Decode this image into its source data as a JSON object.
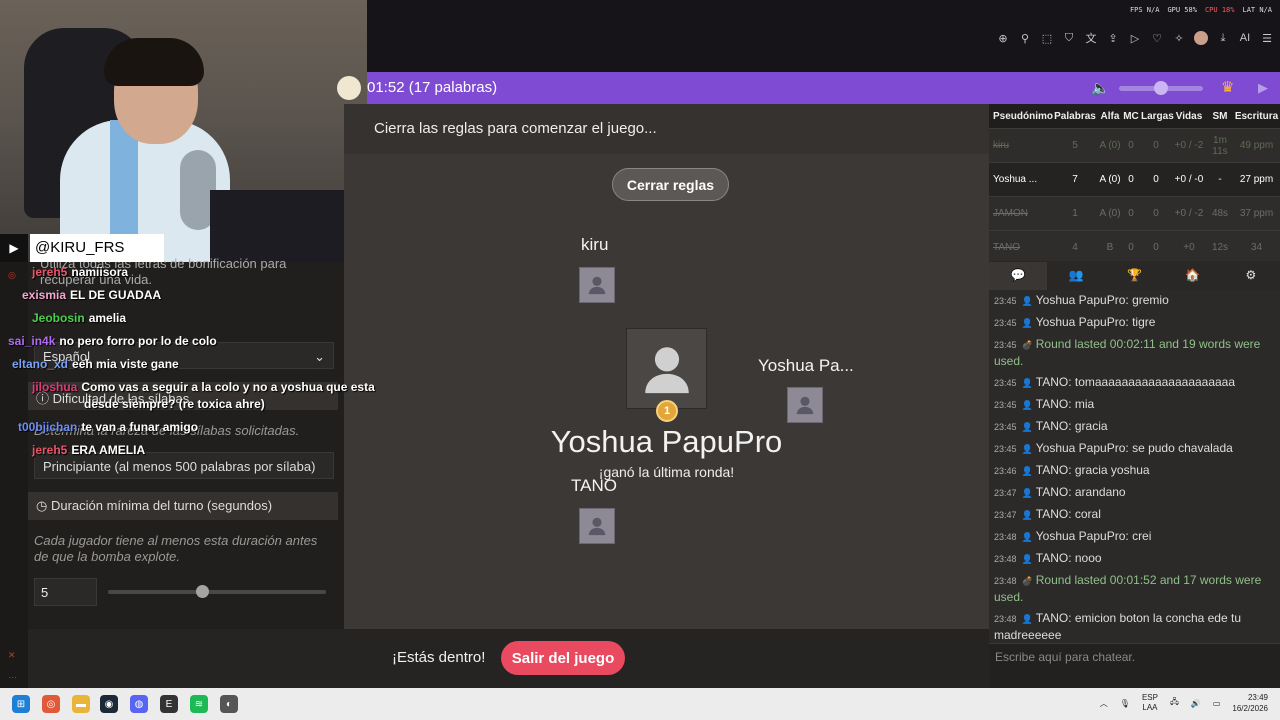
{
  "perf": [
    {
      "label": "FPS N/A",
      "bad": false
    },
    {
      "label": "GPU 58%",
      "bad": false
    },
    {
      "label": "CPU 18%",
      "bad": true
    },
    {
      "label": "LAT N/A",
      "bad": false
    }
  ],
  "toolbar": {
    "icons": [
      "zoom-icon",
      "pin-icon",
      "crop-icon",
      "shield-icon",
      "translate-icon",
      "share-icon",
      "cast-icon",
      "heart-icon",
      "extensions-icon",
      "avatar",
      "download-icon",
      "ai-icon",
      "menu-icon"
    ],
    "ai_label": "AI"
  },
  "game": {
    "timer": "01:52 (17 palabras)",
    "rules_notice": "Cierra las reglas para comenzar el juego...",
    "close_rules": "Cerrar reglas",
    "players": [
      {
        "name": "kiru"
      },
      {
        "name": "Yoshua Pa..."
      },
      {
        "name": "TANO"
      }
    ],
    "winner_rank": "1",
    "winner_name": "Yoshua PapuPro",
    "winner_sub": "¡ganó la última ronda!",
    "inside": "¡Estás dentro!",
    "leave": "Salir del juego"
  },
  "settings": {
    "bonus_hint": "Utiliza todas las letras de bonificación para recuperar una vida.",
    "language": "Español",
    "difficulty_header": "Dificultad de las sílabas",
    "difficulty_hint": "Determina la rareza de las sílabas solicitadas.",
    "difficulty_value": "Principiante (al menos 500 palabras por sílaba)",
    "duration_header": "Duración mínima del turno (segundos)",
    "duration_hint": "Cada jugador tiene al menos esta duración antes de que la bomba explote.",
    "duration_value": "5",
    "duration_level": 0.43
  },
  "stream": {
    "handle": "@KIRU_FRS",
    "chat": [
      {
        "user": "jereh5",
        "text": "namiisora",
        "color": "#e8556b"
      },
      {
        "user": "exismia",
        "text": "EL DE GUADAA",
        "color": "#f4a7d0"
      },
      {
        "user": "Jeobosin",
        "text": "amelia",
        "color": "#4ad14a"
      },
      {
        "user": "sai_in4k",
        "text": "no pero forro por lo de colo",
        "color": "#b06cf0"
      },
      {
        "user": "eltano_xd",
        "text": "eeh mia viste gane",
        "color": "#7aa3f5"
      },
      {
        "user": "jiloshua",
        "text": "Como vas a seguir a la colo y no a yoshua que esta",
        "color": "#e03a7a"
      },
      {
        "user": "",
        "text": "desde siempre? (re toxica ahre)",
        "color": "#fff"
      },
      {
        "user": "t00bjichan",
        "text": "te van a funar amigo",
        "color": "#6b8df5"
      },
      {
        "user": "jereh5",
        "text": "ERA AMELIA",
        "color": "#e8556b"
      }
    ]
  },
  "scoreboard": {
    "headers": [
      "Pseudónimo",
      "Palabras",
      "Alfa",
      "MC",
      "Largas",
      "Vidas",
      "SM",
      "Escritura"
    ],
    "rows": [
      {
        "name": "kiru",
        "words": "5",
        "alpha": "A (0)",
        "mc": "0",
        "long": "0",
        "lives": "+0 / -2",
        "sm": "1m 11s",
        "wpm": "49 ppm",
        "style": "dim"
      },
      {
        "name": "Yoshua ...",
        "words": "7",
        "alpha": "A (0)",
        "mc": "0",
        "long": "0",
        "lives": "+0 / -0",
        "sm": "-",
        "wpm": "27 ppm",
        "style": "bright"
      },
      {
        "name": "JAMON",
        "words": "1",
        "alpha": "A (0)",
        "mc": "0",
        "long": "0",
        "lives": "+0 / -2",
        "sm": "48s",
        "wpm": "37 ppm",
        "style": "dimg"
      },
      {
        "name": "TANO",
        "words": "4",
        "alpha": "B",
        "mc": "0",
        "long": "0",
        "lives": "+0",
        "sm": "12s",
        "wpm": "34",
        "style": "dimg"
      }
    ]
  },
  "chat": {
    "tabs": [
      "chat-icon",
      "people-icon",
      "trophy-icon",
      "home-icon",
      "settings-icon"
    ],
    "messages": [
      {
        "time": "23:45",
        "user": "Yoshua PapuPro",
        "text": "gremio",
        "sys": false
      },
      {
        "time": "23:45",
        "user": "Yoshua PapuPro",
        "text": "tigre",
        "sys": false
      },
      {
        "time": "23:45",
        "user": "",
        "text": "Round lasted 00:02:11 and 19 words were used.",
        "sys": true
      },
      {
        "time": "23:45",
        "user": "TANO",
        "text": "tomaaaaaaaaaaaaaaaaaaaaa",
        "sys": false
      },
      {
        "time": "23:45",
        "user": "TANO",
        "text": "mia",
        "sys": false
      },
      {
        "time": "23:45",
        "user": "TANO",
        "text": "gracia",
        "sys": false
      },
      {
        "time": "23:45",
        "user": "Yoshua PapuPro",
        "text": "se pudo chavalada",
        "sys": false
      },
      {
        "time": "23:46",
        "user": "TANO",
        "text": "gracia yoshua",
        "sys": false
      },
      {
        "time": "23:47",
        "user": "TANO",
        "text": "arandano",
        "sys": false
      },
      {
        "time": "23:47",
        "user": "TANO",
        "text": "coral",
        "sys": false
      },
      {
        "time": "23:48",
        "user": "Yoshua PapuPro",
        "text": "crei",
        "sys": false
      },
      {
        "time": "23:48",
        "user": "TANO",
        "text": "nooo",
        "sys": false
      },
      {
        "time": "23:48",
        "user": "",
        "text": "Round lasted 00:01:52 and 17 words were used.",
        "sys": true
      },
      {
        "time": "23:48",
        "user": "TANO",
        "text": "emicion boton la concha ede tu madreeeeee",
        "sys": false
      }
    ],
    "placeholder": "Escribe aquí para chatear."
  },
  "taskbar": {
    "lang": "ESP",
    "layout": "LAA",
    "time": "23:49",
    "date": "16/2/2026"
  }
}
